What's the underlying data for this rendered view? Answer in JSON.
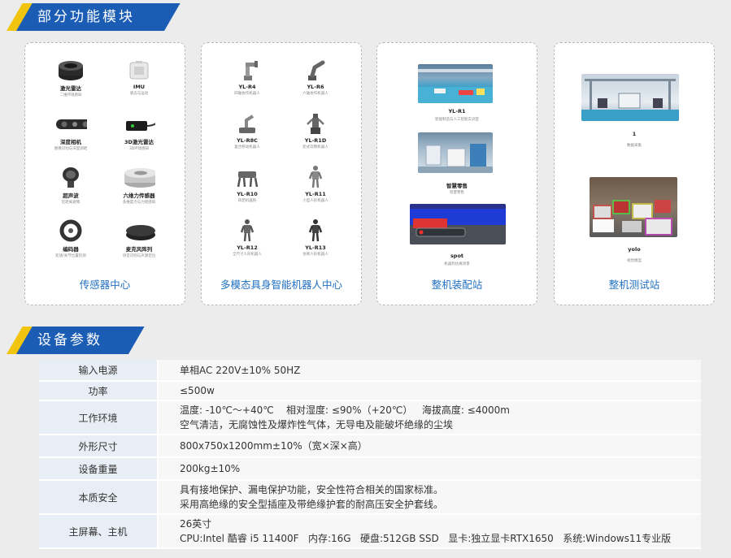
{
  "section1": {
    "title": "部分功能模块"
  },
  "section2": {
    "title": "设备参数"
  },
  "cards": [
    {
      "title": "传感器中心",
      "items": [
        {
          "name": "激光雷达",
          "desc": "二维环境感知",
          "icon": "lidar-icon"
        },
        {
          "name": "IMU",
          "desc": "姿态与运动",
          "icon": "imu-icon"
        },
        {
          "name": "深度相机",
          "desc": "图像识别与深度测距",
          "icon": "depth-camera-icon"
        },
        {
          "name": "3D激光雷达",
          "desc": "3D环境感知",
          "icon": "3d-lidar-icon"
        },
        {
          "name": "超声波",
          "desc": "近距离避障",
          "icon": "ultrasonic-icon"
        },
        {
          "name": "六维力传感器",
          "desc": "多维度力与力矩感知",
          "icon": "force-sensor-icon"
        },
        {
          "name": "编码器",
          "desc": "轮速/关节位置检测",
          "icon": "encoder-icon"
        },
        {
          "name": "麦克风阵列",
          "desc": "语音识别与声源定位",
          "icon": "microphone-array-icon"
        }
      ]
    },
    {
      "title": "多模态具身智能机器人中心",
      "items": [
        {
          "name": "YL-R4",
          "desc": "四轴协作机器人",
          "icon": "robot-arm-icon"
        },
        {
          "name": "YL-R6",
          "desc": "六轴协作机器人",
          "icon": "robot-arm-icon"
        },
        {
          "name": "YL-R8C",
          "desc": "复合移动机器人",
          "icon": "mobile-manipulator-icon"
        },
        {
          "name": "YL-R1D",
          "desc": "轮式双臂机器人",
          "icon": "dual-arm-robot-icon"
        },
        {
          "name": "YL-R10",
          "desc": "四足机器狗",
          "icon": "quadruped-icon"
        },
        {
          "name": "YL-R11",
          "desc": "小型人形机器人",
          "icon": "humanoid-icon"
        },
        {
          "name": "YL-R12",
          "desc": "全尺寸人形机器人",
          "icon": "humanoid-icon"
        },
        {
          "name": "YL-R13",
          "desc": "仿真人形机器人",
          "icon": "humanoid-icon"
        }
      ]
    },
    {
      "title": "整机装配站",
      "photos": [
        {
          "name": "YL-R1",
          "desc": "智能制造与人工智能实训室"
        },
        {
          "name": "智慧零售",
          "desc": "智慧零售"
        },
        {
          "name": "spot",
          "desc": "机器狗仿真场景"
        }
      ]
    },
    {
      "title": "整机测试站",
      "photos": [
        {
          "name": "1",
          "desc": "数据采集"
        },
        {
          "name": "yolo",
          "desc": "视觉模型"
        }
      ]
    }
  ],
  "specs": [
    {
      "key": "输入电源",
      "lines": [
        "单相AC 220V±10% 50HZ"
      ]
    },
    {
      "key": "功率",
      "lines": [
        "≤500w"
      ]
    },
    {
      "key": "工作环境",
      "lines": [
        "温度: -10℃～+40℃    相对湿度: ≤90%（+20℃）   海拔高度: ≤4000m",
        "空气清洁，无腐蚀性及爆炸性气体，无导电及能破坏绝缘的尘埃"
      ]
    },
    {
      "key": "外形尺寸",
      "lines": [
        "800x750x1200mm±10%（宽×深×高）"
      ]
    },
    {
      "key": "设备重量",
      "lines": [
        "200kg±10%"
      ]
    },
    {
      "key": "本质安全",
      "lines": [
        "具有接地保护、漏电保护功能，安全性符合相关的国家标准。",
        "采用高绝缘的安全型插座及带绝缘护套的耐高压安全护套线。"
      ]
    },
    {
      "key": "主屏幕、主机",
      "lines": [
        "26英寸",
        "CPU:Intel 酷睿 i5 11400F   内存:16G   硬盘:512GB SSD   显卡:独立显卡RTX1650   系统:Windows11专业版"
      ]
    }
  ],
  "colors": {
    "accent_blue": "#1b5db5",
    "accent_yellow": "#f1c40f",
    "link_blue": "#1f6fc0"
  }
}
